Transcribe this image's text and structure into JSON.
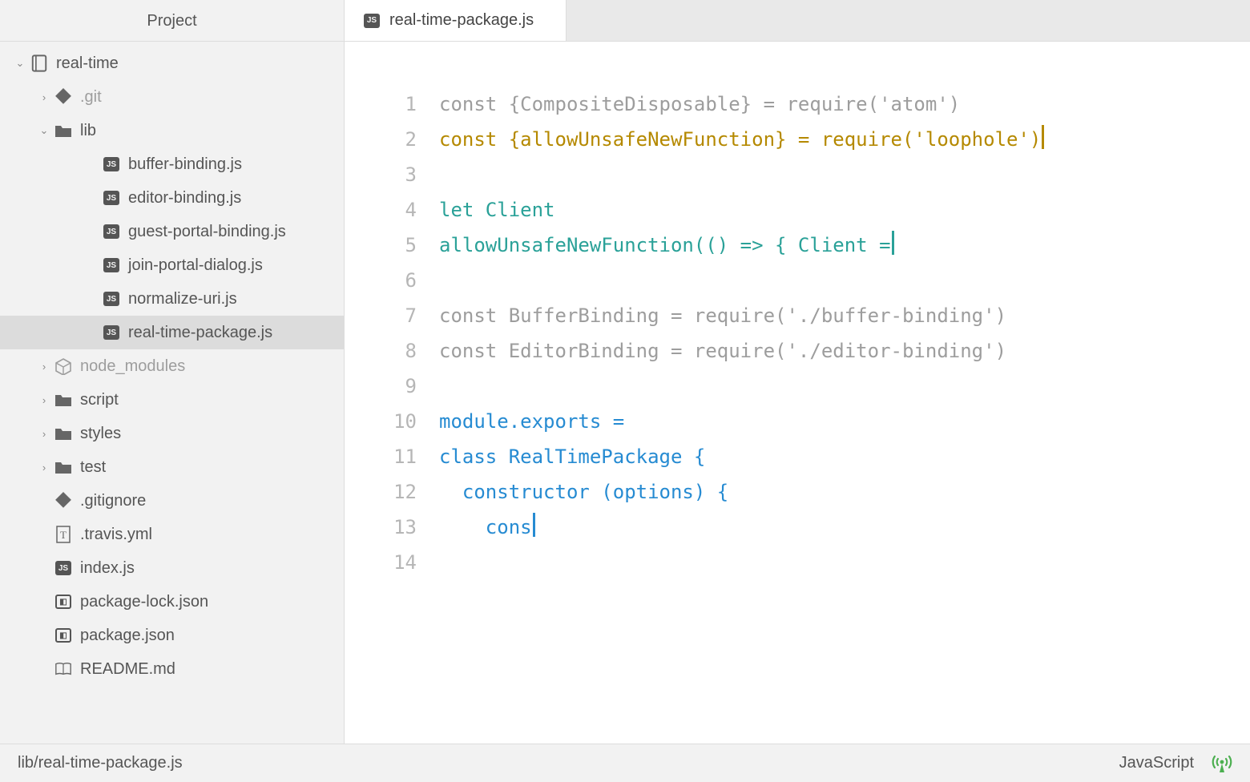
{
  "sidebar": {
    "title": "Project",
    "tree": [
      {
        "label": "real-time",
        "indent": 0,
        "icon": "repo",
        "chev": "down",
        "muted": false,
        "selected": false
      },
      {
        "label": ".git",
        "indent": 1,
        "icon": "git",
        "chev": "right",
        "muted": true,
        "selected": false
      },
      {
        "label": "lib",
        "indent": 1,
        "icon": "folder",
        "chev": "down",
        "muted": false,
        "selected": false
      },
      {
        "label": "buffer-binding.js",
        "indent": 3,
        "icon": "js",
        "chev": "none",
        "muted": false,
        "selected": false
      },
      {
        "label": "editor-binding.js",
        "indent": 3,
        "icon": "js",
        "chev": "none",
        "muted": false,
        "selected": false
      },
      {
        "label": "guest-portal-binding.js",
        "indent": 3,
        "icon": "js",
        "chev": "none",
        "muted": false,
        "selected": false
      },
      {
        "label": "join-portal-dialog.js",
        "indent": 3,
        "icon": "js",
        "chev": "none",
        "muted": false,
        "selected": false
      },
      {
        "label": "normalize-uri.js",
        "indent": 3,
        "icon": "js",
        "chev": "none",
        "muted": false,
        "selected": false
      },
      {
        "label": "real-time-package.js",
        "indent": 3,
        "icon": "js",
        "chev": "none",
        "muted": false,
        "selected": true
      },
      {
        "label": "node_modules",
        "indent": 1,
        "icon": "pkg",
        "chev": "right",
        "muted": true,
        "selected": false
      },
      {
        "label": "script",
        "indent": 1,
        "icon": "folder",
        "chev": "right",
        "muted": false,
        "selected": false
      },
      {
        "label": "styles",
        "indent": 1,
        "icon": "folder",
        "chev": "right",
        "muted": false,
        "selected": false
      },
      {
        "label": "test",
        "indent": 1,
        "icon": "folder",
        "chev": "right",
        "muted": false,
        "selected": false
      },
      {
        "label": ".gitignore",
        "indent": 1,
        "icon": "git",
        "chev": "none",
        "muted": false,
        "selected": false
      },
      {
        "label": ".travis.yml",
        "indent": 1,
        "icon": "text",
        "chev": "none",
        "muted": false,
        "selected": false
      },
      {
        "label": "index.js",
        "indent": 1,
        "icon": "js",
        "chev": "none",
        "muted": false,
        "selected": false
      },
      {
        "label": "package-lock.json",
        "indent": 1,
        "icon": "db",
        "chev": "none",
        "muted": false,
        "selected": false
      },
      {
        "label": "package.json",
        "indent": 1,
        "icon": "db",
        "chev": "none",
        "muted": false,
        "selected": false
      },
      {
        "label": "README.md",
        "indent": 1,
        "icon": "book",
        "chev": "none",
        "muted": false,
        "selected": false
      }
    ]
  },
  "tab": {
    "label": "real-time-package.js"
  },
  "editor": {
    "lines": [
      {
        "n": "1",
        "segs": [
          [
            "gray",
            "const {CompositeDisposable} = require('atom')"
          ]
        ],
        "cursor": null
      },
      {
        "n": "2",
        "segs": [
          [
            "amber",
            "const {allowUnsafeNewFunction} = require('loophole')"
          ]
        ],
        "cursor": "amber"
      },
      {
        "n": "3",
        "segs": [],
        "cursor": null
      },
      {
        "n": "4",
        "segs": [
          [
            "teal",
            "let Client"
          ]
        ],
        "cursor": null
      },
      {
        "n": "5",
        "segs": [
          [
            "teal",
            "allowUnsafeNewFunction(() => { Client ="
          ]
        ],
        "cursor": "teal"
      },
      {
        "n": "6",
        "segs": [],
        "cursor": null
      },
      {
        "n": "7",
        "segs": [
          [
            "gray",
            "const BufferBinding = require('./buffer-binding')"
          ]
        ],
        "cursor": null
      },
      {
        "n": "8",
        "segs": [
          [
            "gray",
            "const EditorBinding = require('./editor-binding')"
          ]
        ],
        "cursor": null
      },
      {
        "n": "9",
        "segs": [],
        "cursor": null
      },
      {
        "n": "10",
        "segs": [
          [
            "blue",
            "module.exports ="
          ]
        ],
        "cursor": null
      },
      {
        "n": "11",
        "segs": [
          [
            "blue",
            "class RealTimePackage {"
          ]
        ],
        "cursor": null
      },
      {
        "n": "12",
        "segs": [
          [
            "blue",
            "  constructor (options) {"
          ]
        ],
        "cursor": null
      },
      {
        "n": "13",
        "segs": [
          [
            "blue",
            "    cons"
          ]
        ],
        "cursor": "blue"
      },
      {
        "n": "14",
        "segs": [],
        "cursor": null
      }
    ]
  },
  "status": {
    "path": "lib/real-time-package.js",
    "language": "JavaScript"
  }
}
